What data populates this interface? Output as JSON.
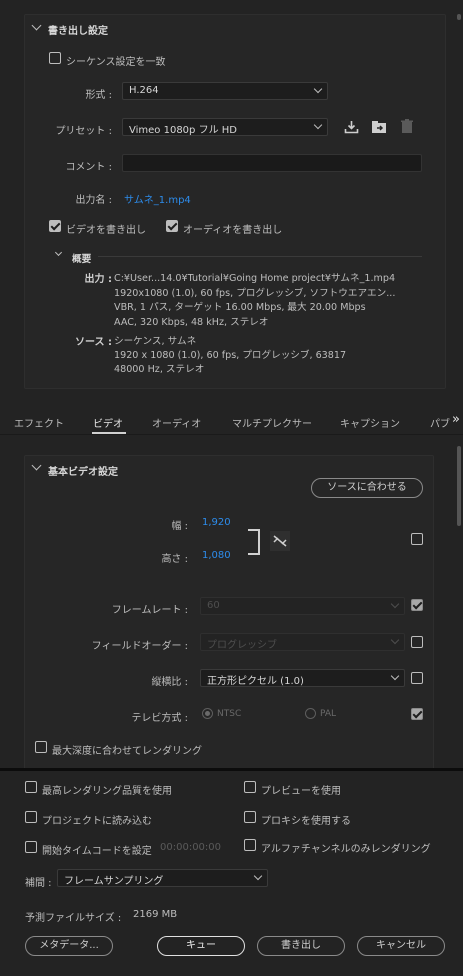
{
  "export_settings": {
    "title": "書き出し設定",
    "match_sequence_label": "シーケンス設定を一致",
    "format_label": "形式 :",
    "format_value": "H.264",
    "preset_label": "プリセット :",
    "preset_value": "Vimeo 1080p フル HD",
    "comment_label": "コメント :",
    "comment_value": "",
    "output_name_label": "出力名 :",
    "output_name_value": "サムネ_1.mp4",
    "export_video_label": "ビデオを書き出し",
    "export_audio_label": "オーディオを書き出し",
    "export_video_checked": true,
    "export_audio_checked": true
  },
  "summary": {
    "title": "概要",
    "output_key": "出力 :",
    "output_lines": [
      "C:¥User...14.0¥Tutorial¥Going  Home  project¥サムネ_1.mp4",
      "1920x1080 (1.0), 60 fps, プログレッシブ, ソフトウエアエン...",
      "VBR, 1 パス, ターゲット 16.00 Mbps, 最大 20.00 Mbps",
      "AAC, 320 Kbps, 48 kHz, ステレオ"
    ],
    "source_key": "ソース :",
    "source_lines": [
      "シーケンス, サムネ",
      "1920 x 1080 (1.0), 60 fps, プログレッシブ, 63817",
      "48000  Hz, ステレオ"
    ]
  },
  "tabs": [
    "エフェクト",
    "ビデオ",
    "オーディオ",
    "マルチプレクサー",
    "キャプション",
    "パブ"
  ],
  "tabs_more": "»",
  "active_tab": "ビデオ",
  "basic_video": {
    "title": "基本ビデオ設定",
    "match_source_button": "ソースに合わせる",
    "width_label": "幅 :",
    "width_value": "1,920",
    "height_label": "高さ :",
    "height_value": "1,080",
    "frame_rate_label": "フレームレート :",
    "frame_rate_value": "60",
    "field_order_label": "フィールドオーダー :",
    "field_order_value": "プログレッシブ",
    "aspect_label": "縦横比 :",
    "aspect_value": "正方形ピクセル (1.0)",
    "tv_standard_label": "テレビ方式 :",
    "ntsc_label": "NTSC",
    "pal_label": "PAL",
    "max_depth_label": "最大深度に合わせてレンダリング"
  },
  "bottom": {
    "max_render_quality": "最高レンダリング品質を使用",
    "use_preview": "プレビューを使用",
    "import_into_project": "プロジェクトに読み込む",
    "use_proxy": "プロキシを使用する",
    "set_start_timecode": "開始タイムコードを設定",
    "timecode_value": "00:00:00:00",
    "render_alpha_only": "アルファチャンネルのみレンダリング",
    "interpolation_label": "補間 :",
    "interpolation_value": "フレームサンプリング",
    "estimated_size_label": "予測ファイルサイズ :",
    "estimated_size_value": "2169 MB",
    "metadata_button": "メタデータ...",
    "queue_button": "キュー",
    "export_button": "書き出し",
    "cancel_button": "キャンセル"
  }
}
